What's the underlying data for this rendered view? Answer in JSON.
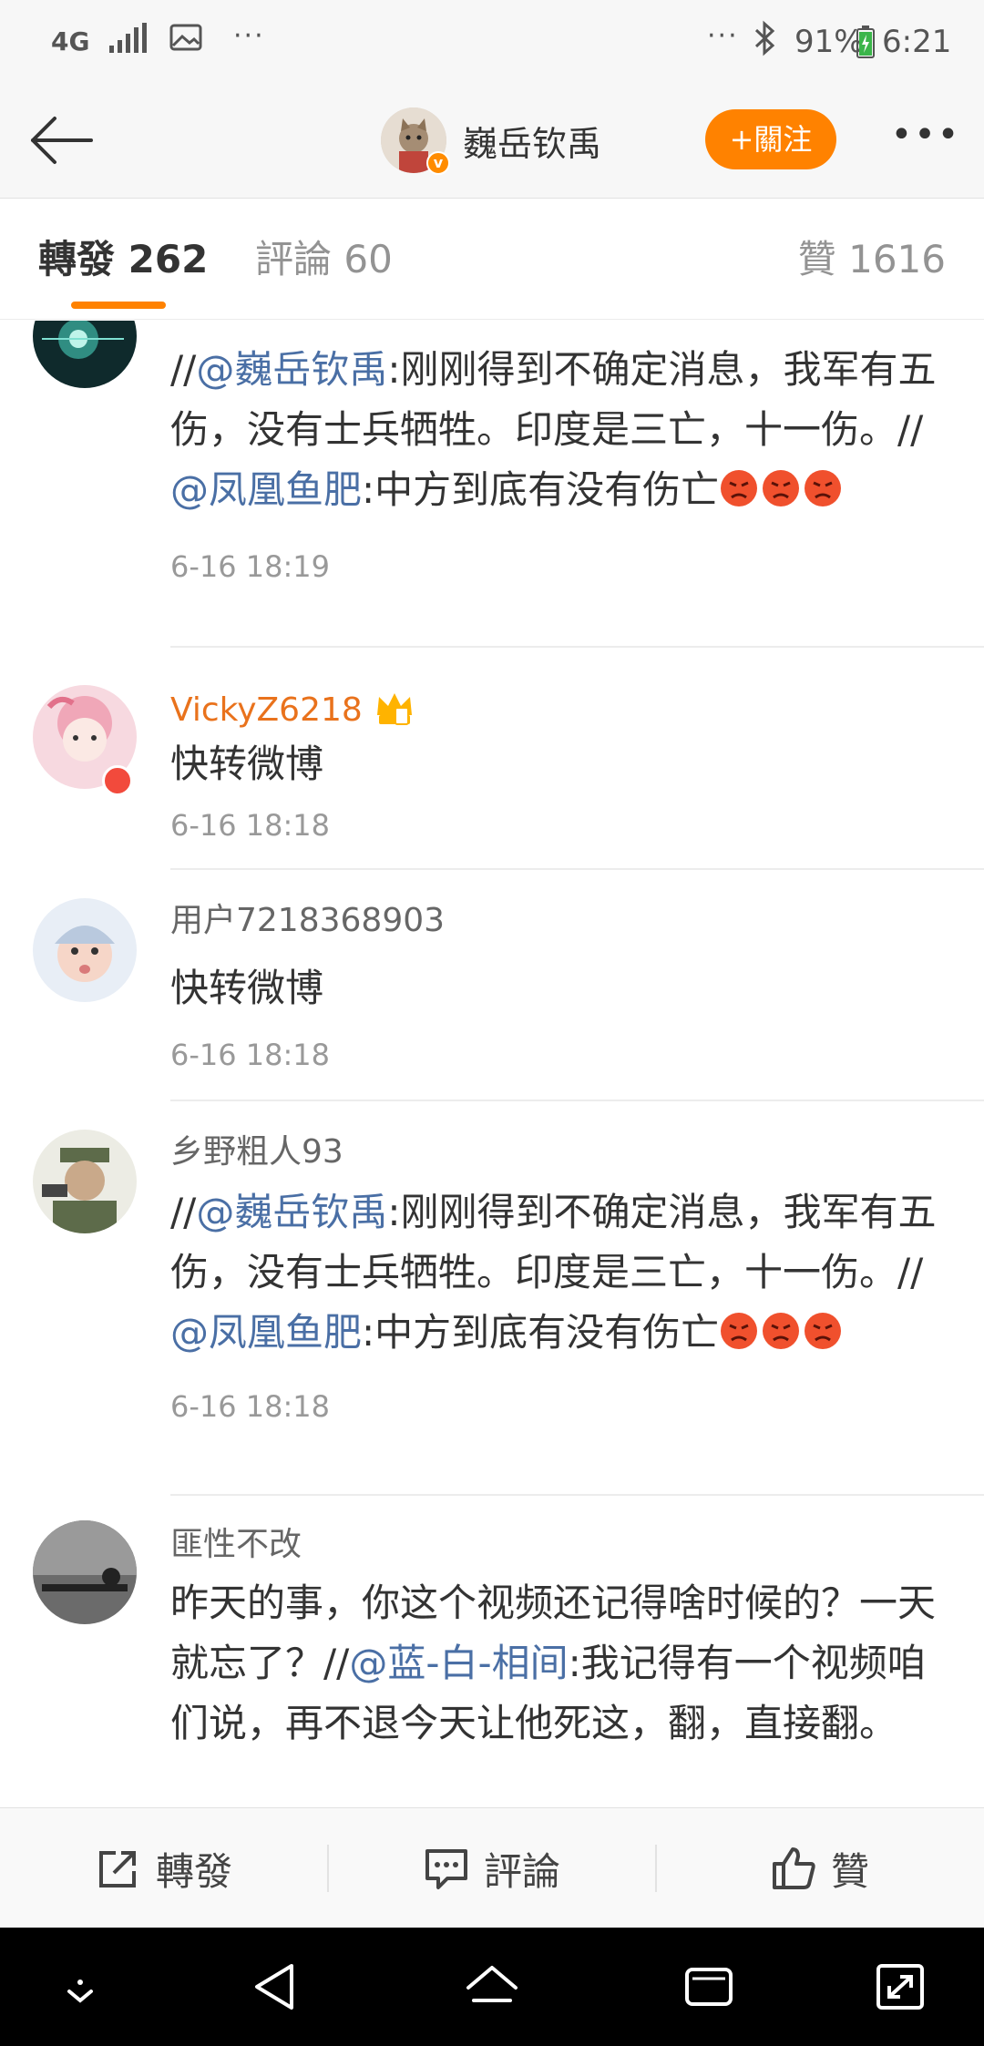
{
  "status_bar": {
    "network": "4G",
    "dots_left": "···",
    "dots_right": "···",
    "battery": "91%",
    "time": "6:21"
  },
  "header": {
    "name": "巍岳钦禹",
    "follow_label": "+關注",
    "more_label": "•••"
  },
  "tabs": {
    "repost": "轉發 262",
    "comment": "評論 60",
    "like": "贊 1616"
  },
  "entries": [
    {
      "username": "",
      "content_parts": [
        "//",
        "@巍岳钦禹",
        ":刚刚得到不确定消息，我军有五伤，没有士兵牺牲。印度是三亡，十一伤。//",
        "@凤凰鱼肥",
        ":中方到底有没有伤亡"
      ],
      "time": "6-16 18:19"
    },
    {
      "username": "VickyZ6218",
      "content": "快转微博",
      "time": "6-16 18:18"
    },
    {
      "username": "用户7218368903",
      "content": "快转微博",
      "time": "6-16 18:18"
    },
    {
      "username": "乡野粗人93",
      "content_parts": [
        "//",
        "@巍岳钦禹",
        ":刚刚得到不确定消息，我军有五伤，没有士兵牺牲。印度是三亡，十一伤。//",
        "@凤凰鱼肥",
        ":中方到底有没有伤亡"
      ],
      "time": "6-16 18:18"
    },
    {
      "username": "匪性不改",
      "content_parts": [
        "昨天的事，你这个视频还记得啥时候的？一天就忘了？//",
        "@蓝-白-相间",
        ":我记得有一个视频咱们说，再不退今天让他死这，翻，直接翻。"
      ]
    }
  ],
  "actions": {
    "repost": "轉發",
    "comment": "評論",
    "like": "贊"
  },
  "icons": {
    "back": "arrow-left-icon",
    "share": "share-icon",
    "comment": "comment-icon",
    "like": "thumbs-up-icon"
  },
  "colors": {
    "accent": "#ff8200",
    "mention": "#4a6fa5",
    "vip_name": "#e9721c"
  }
}
